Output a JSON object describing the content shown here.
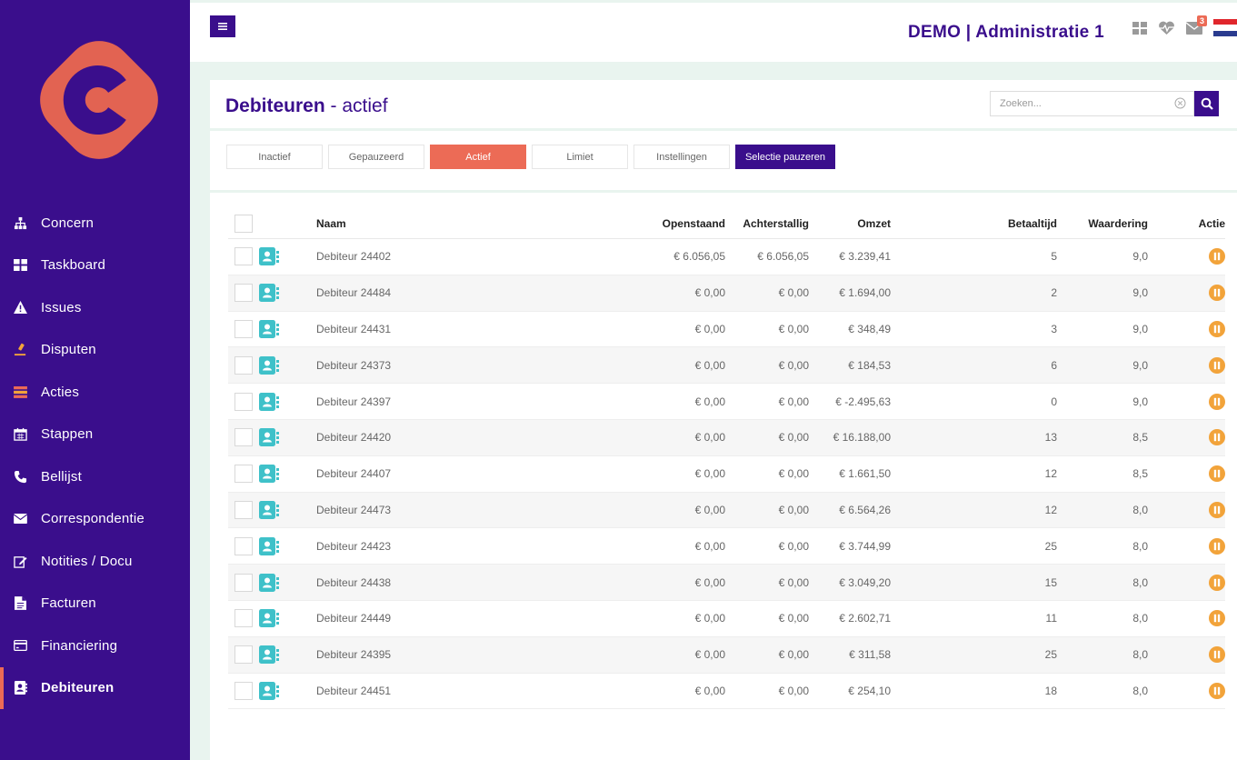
{
  "sidebar": {
    "items": [
      {
        "label": "Concern",
        "icon": "sitemap-icon"
      },
      {
        "label": "Taskboard",
        "icon": "grid-icon"
      },
      {
        "label": "Issues",
        "icon": "warning-icon"
      },
      {
        "label": "Disputen",
        "icon": "gavel-icon"
      },
      {
        "label": "Acties",
        "icon": "list-icon"
      },
      {
        "label": "Stappen",
        "icon": "calendar-icon"
      },
      {
        "label": "Bellijst",
        "icon": "phone-icon"
      },
      {
        "label": "Correspondentie",
        "icon": "envelope-icon"
      },
      {
        "label": "Notities / Docu",
        "icon": "edit-icon"
      },
      {
        "label": "Facturen",
        "icon": "file-icon"
      },
      {
        "label": "Financiering",
        "icon": "credit-card-icon"
      },
      {
        "label": "Debiteuren",
        "icon": "contact-book-icon"
      }
    ],
    "active_index": 11
  },
  "topbar": {
    "title": "DEMO | Administratie 1",
    "mail_badge": "3"
  },
  "page": {
    "title_bold": "Debiteuren",
    "title_rest": " - actief"
  },
  "search": {
    "placeholder": "Zoeken..."
  },
  "tabs": [
    {
      "label": "Inactief",
      "style": "default"
    },
    {
      "label": "Gepauzeerd",
      "style": "default"
    },
    {
      "label": "Actief",
      "style": "active"
    },
    {
      "label": "Limiet",
      "style": "default"
    },
    {
      "label": "Instellingen",
      "style": "default"
    },
    {
      "label": "Selectie pauzeren",
      "style": "primary"
    }
  ],
  "table": {
    "headers": {
      "naam": "Naam",
      "openstaand": "Openstaand",
      "achterstallig": "Achterstallig",
      "omzet": "Omzet",
      "betaaltijd": "Betaaltijd",
      "waardering": "Waardering",
      "actie": "Actie"
    },
    "rows": [
      {
        "naam": "Debiteur 24402",
        "openstaand": "€ 6.056,05",
        "achterstallig": "€ 6.056,05",
        "omzet": "€ 3.239,41",
        "betaaltijd": "5",
        "waardering": "9,0"
      },
      {
        "naam": "Debiteur 24484",
        "openstaand": "€ 0,00",
        "achterstallig": "€ 0,00",
        "omzet": "€ 1.694,00",
        "betaaltijd": "2",
        "waardering": "9,0"
      },
      {
        "naam": "Debiteur 24431",
        "openstaand": "€ 0,00",
        "achterstallig": "€ 0,00",
        "omzet": "€ 348,49",
        "betaaltijd": "3",
        "waardering": "9,0"
      },
      {
        "naam": "Debiteur 24373",
        "openstaand": "€ 0,00",
        "achterstallig": "€ 0,00",
        "omzet": "€ 184,53",
        "betaaltijd": "6",
        "waardering": "9,0"
      },
      {
        "naam": "Debiteur 24397",
        "openstaand": "€ 0,00",
        "achterstallig": "€ 0,00",
        "omzet": "€ -2.495,63",
        "betaaltijd": "0",
        "waardering": "9,0"
      },
      {
        "naam": "Debiteur 24420",
        "openstaand": "€ 0,00",
        "achterstallig": "€ 0,00",
        "omzet": "€ 16.188,00",
        "betaaltijd": "13",
        "waardering": "8,5"
      },
      {
        "naam": "Debiteur 24407",
        "openstaand": "€ 0,00",
        "achterstallig": "€ 0,00",
        "omzet": "€ 1.661,50",
        "betaaltijd": "12",
        "waardering": "8,5"
      },
      {
        "naam": "Debiteur 24473",
        "openstaand": "€ 0,00",
        "achterstallig": "€ 0,00",
        "omzet": "€ 6.564,26",
        "betaaltijd": "12",
        "waardering": "8,0"
      },
      {
        "naam": "Debiteur 24423",
        "openstaand": "€ 0,00",
        "achterstallig": "€ 0,00",
        "omzet": "€ 3.744,99",
        "betaaltijd": "25",
        "waardering": "8,0"
      },
      {
        "naam": "Debiteur 24438",
        "openstaand": "€ 0,00",
        "achterstallig": "€ 0,00",
        "omzet": "€ 3.049,20",
        "betaaltijd": "15",
        "waardering": "8,0"
      },
      {
        "naam": "Debiteur 24449",
        "openstaand": "€ 0,00",
        "achterstallig": "€ 0,00",
        "omzet": "€ 2.602,71",
        "betaaltijd": "11",
        "waardering": "8,0"
      },
      {
        "naam": "Debiteur 24395",
        "openstaand": "€ 0,00",
        "achterstallig": "€ 0,00",
        "omzet": "€ 311,58",
        "betaaltijd": "25",
        "waardering": "8,0"
      },
      {
        "naam": "Debiteur 24451",
        "openstaand": "€ 0,00",
        "achterstallig": "€ 0,00",
        "omzet": "€ 254,10",
        "betaaltijd": "18",
        "waardering": "8,0"
      }
    ]
  },
  "colors": {
    "brand_purple": "#3a0e8c",
    "accent_coral": "#ec6b56",
    "teal": "#3fc1c9",
    "pause_orange": "#f2a33a",
    "background": "#e9f4ef"
  }
}
